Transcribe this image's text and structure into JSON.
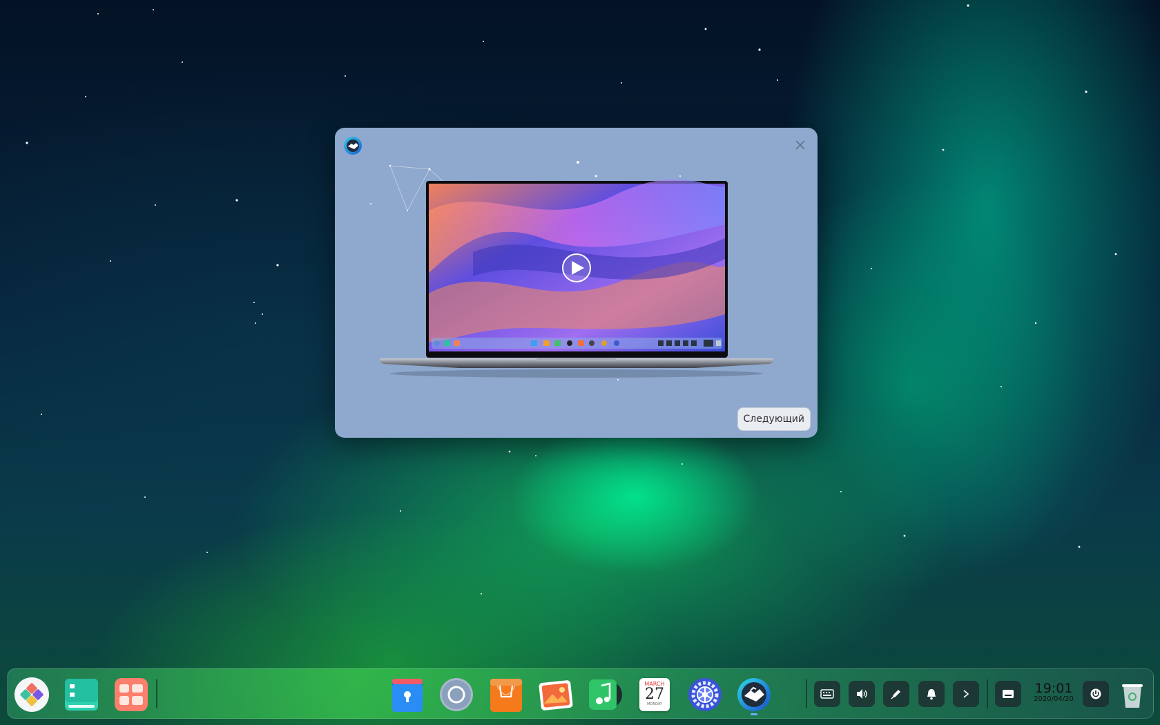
{
  "dialog": {
    "next_label": "Следующий",
    "calendar_month": "MARCH",
    "calendar_day": "27"
  },
  "dock": {
    "calendar_month": "MARCH",
    "calendar_day": "27",
    "calendar_weekday": "MONDAY",
    "clock_time": "19:01",
    "clock_date": "2020/04/20"
  },
  "colors": {
    "dialog_bg": "#8fa8cd",
    "tray_button_bg": "#1e282d",
    "dock_gradient": [
      "#288c5a",
      "#3cc850",
      "#1e5a50"
    ]
  },
  "icons": [
    "launcher-icon",
    "multitasking-view-icon",
    "show-desktop-icon",
    "file-manager-icon",
    "browser-icon",
    "app-store-icon",
    "image-viewer-icon",
    "music-icon",
    "calendar-icon",
    "control-center-icon",
    "welcome-icon",
    "keyboard-icon",
    "volume-icon",
    "pen-icon",
    "bell-icon",
    "chevron-right-icon",
    "onboard-icon",
    "power-icon",
    "trash-icon",
    "close-icon",
    "play-icon"
  ]
}
